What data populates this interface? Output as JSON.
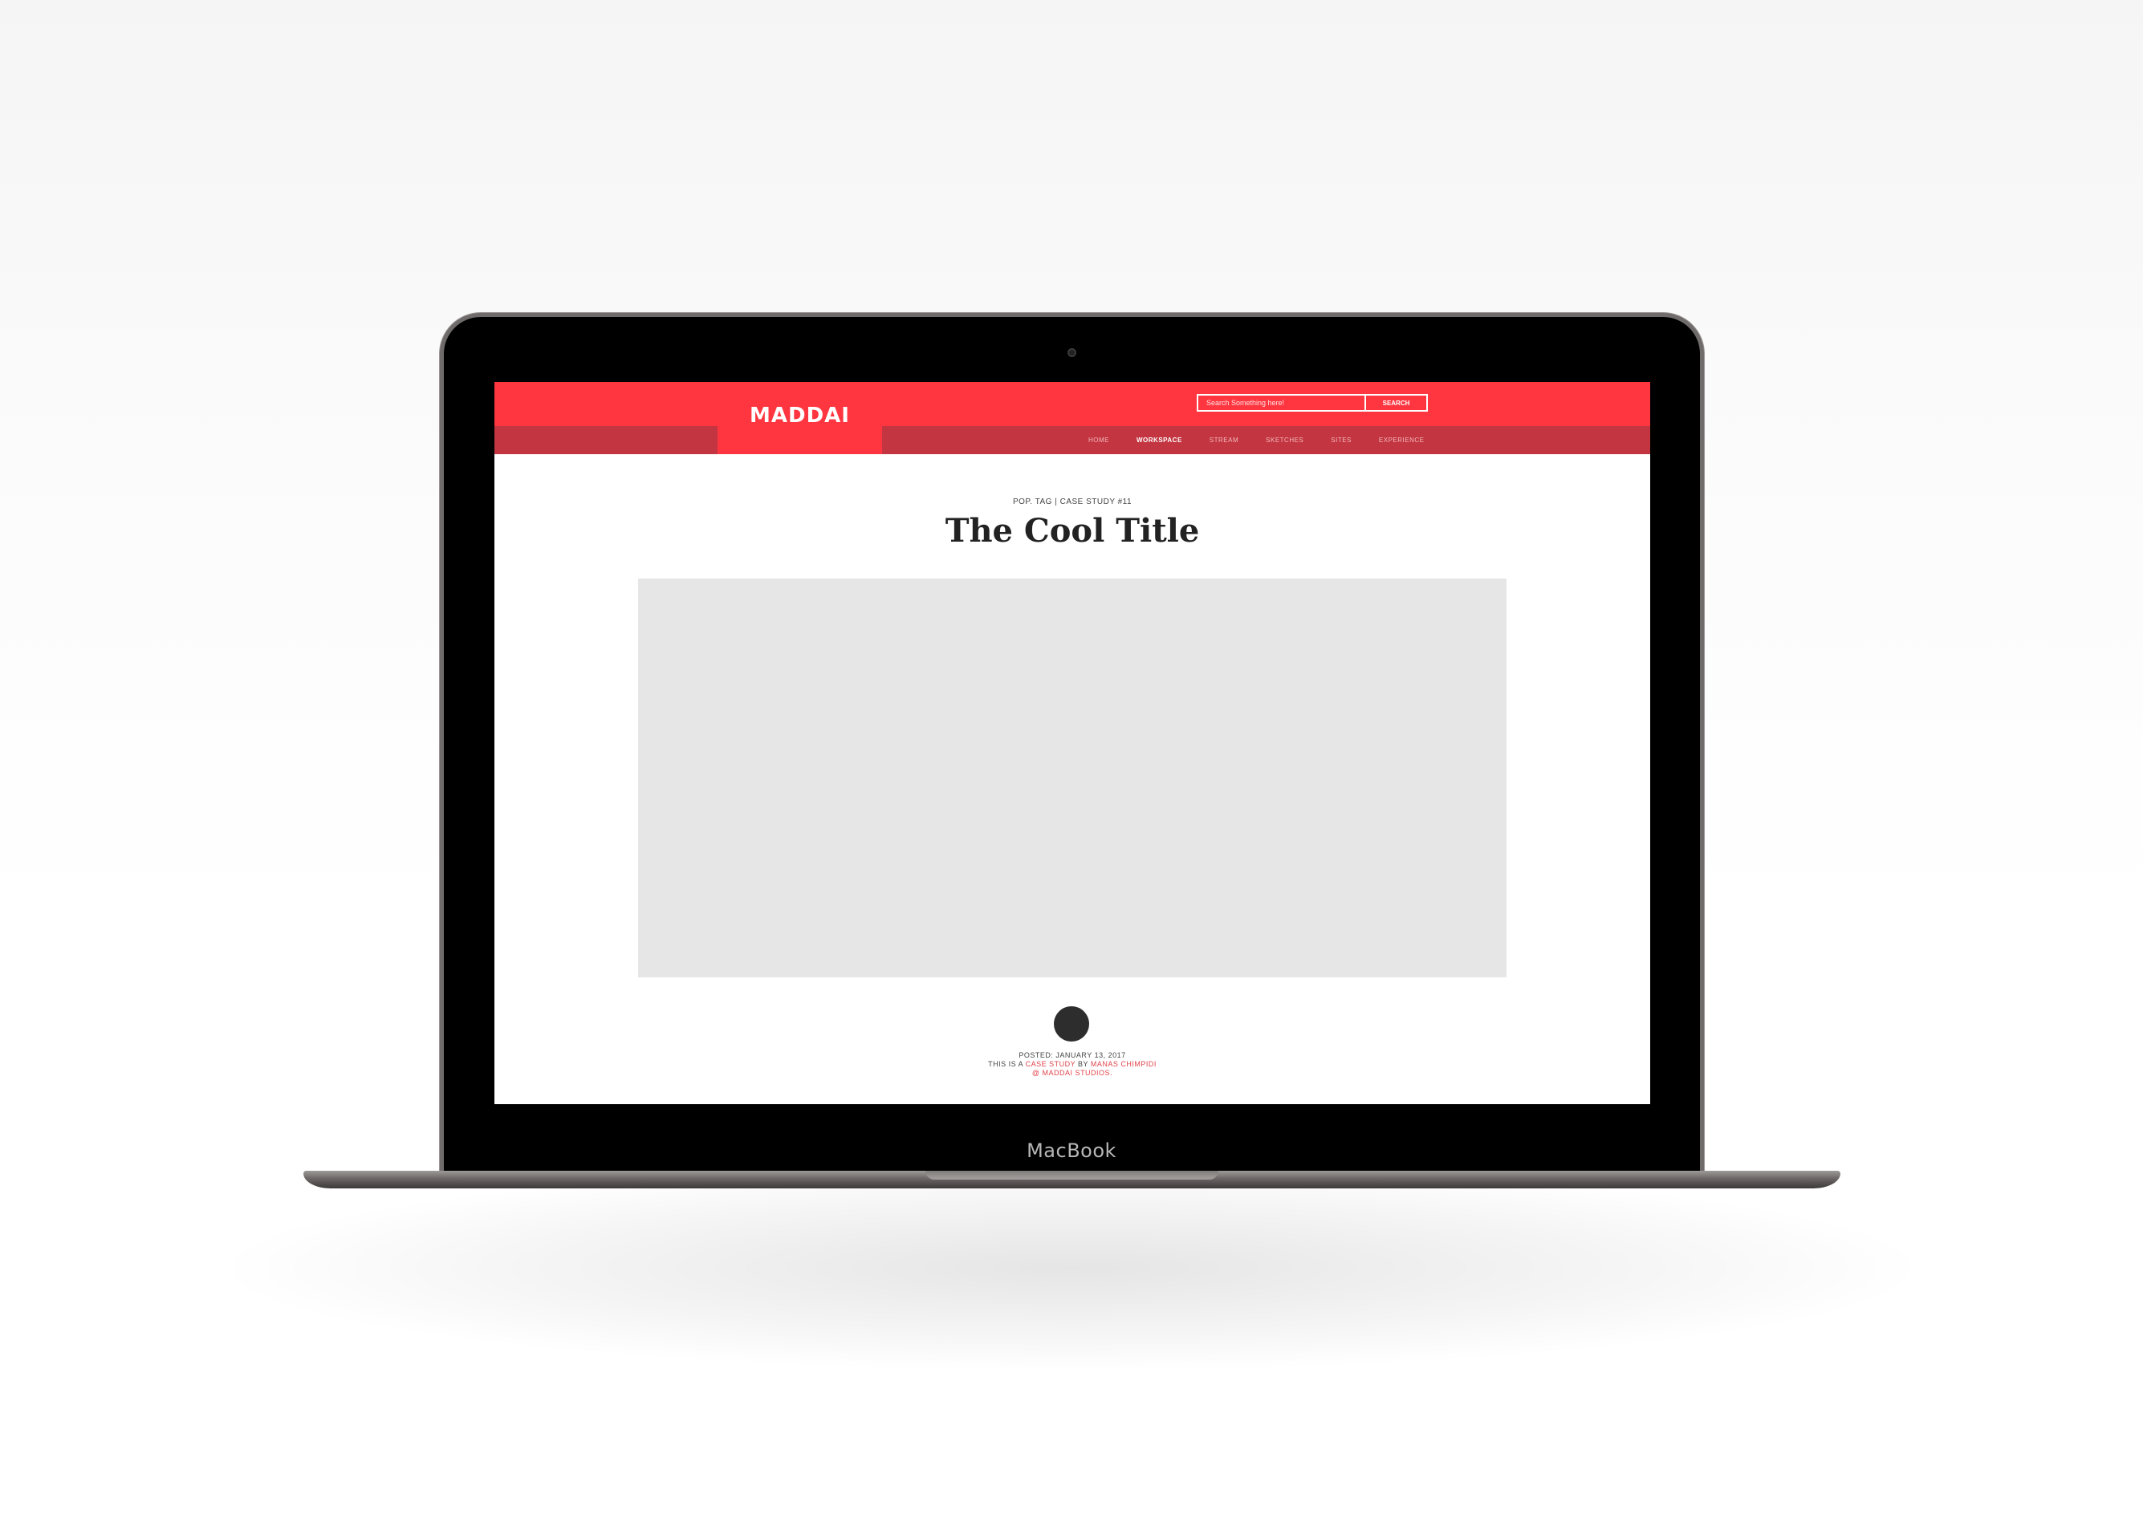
{
  "device": {
    "brand_label": "MacBook"
  },
  "site": {
    "logo_text": "MADDAI",
    "accent_color": "#ff3640",
    "accent_dark_color": "#c33540",
    "search": {
      "placeholder": "Search Something here!",
      "button_label": "SEARCH"
    },
    "nav": {
      "items": [
        {
          "label": "HOME",
          "active": false
        },
        {
          "label": "WORKSPACE",
          "active": true
        },
        {
          "label": "STREAM",
          "active": false
        },
        {
          "label": "SKETCHES",
          "active": false
        },
        {
          "label": "SITES",
          "active": false
        },
        {
          "label": "EXPERIENCE",
          "active": false
        }
      ]
    }
  },
  "article": {
    "tagline": "POP. TAG | CASE STUDY #11",
    "title": "The Cool Title",
    "posted_line": "POSTED: JANUARY 13, 2017",
    "byline_prefix": "THIS IS A ",
    "byline_type": "CASE STUDY",
    "byline_by": " BY ",
    "byline_author": "MANAS CHIMPIDI",
    "byline_studio": "@ MADDAI STUDIOS."
  }
}
